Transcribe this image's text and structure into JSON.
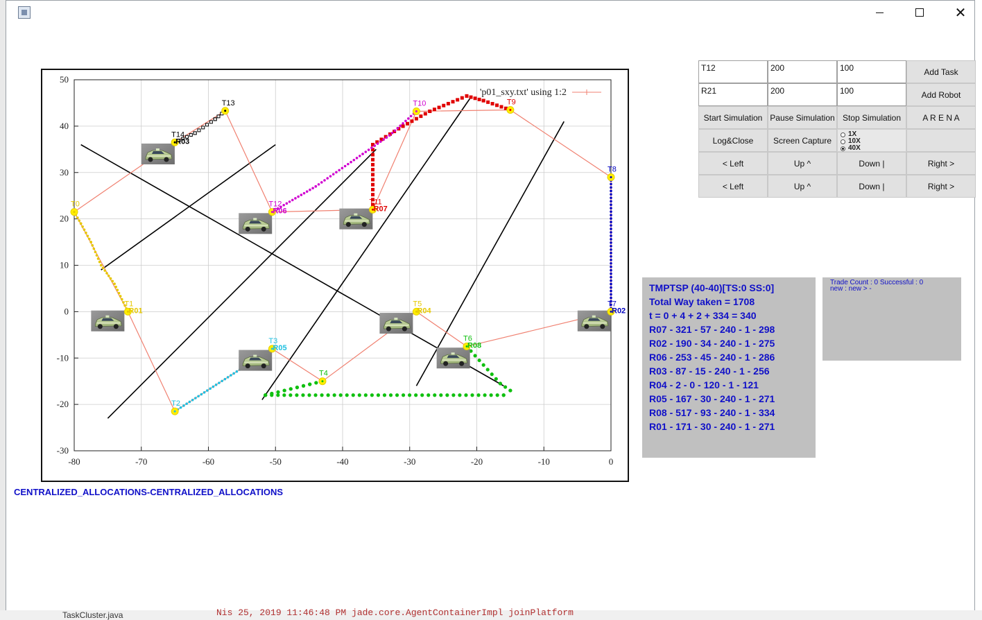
{
  "window": {
    "close_glyph": "✕",
    "bottom_code": "Nis 25, 2019 11:46:48 PM jade.core.AgentContainerImpl joinPlatform",
    "bottom_tree": "TaskCluster.java"
  },
  "allocation_label": "CENTRALIZED_ALLOCATIONS-CENTRALIZED_ALLOCATIONS",
  "controls": {
    "task_fields": [
      "T12",
      "200",
      "100"
    ],
    "add_task": "Add Task",
    "robot_fields": [
      "R21",
      "200",
      "100"
    ],
    "add_robot": "Add Robot",
    "start_simulation": "Start Simulation",
    "pause_simulation": "Pause Simulation",
    "stop_simulation": "Stop Simulation",
    "arena": "A R E N A",
    "log_close": "Log&Close",
    "screen_capture": "Screen Capture",
    "speed_options": [
      "1X",
      "10X",
      "40X"
    ],
    "speed_selected": "40X",
    "move_row_1": [
      "< Left",
      "Up ^",
      "Down |",
      "Right >"
    ],
    "move_row_2": [
      "< Left",
      "Up ^",
      "Down |",
      "Right >"
    ]
  },
  "info_panel": {
    "lines": [
      "TMPTSP (40-40)[TS:0 SS:0]",
      "Total Way taken =  1708",
      "t = 0 + 4 + 2 + 334 = 340",
      "R07 - 321 - 57 - 240 - 1 - 298",
      "R02 - 190 - 34 - 240 - 1 - 275",
      "R06 - 253 - 45 - 240 - 1 - 286",
      "R03 - 87 - 15 - 240 - 1 - 256",
      "R04 - 2 - 0 - 120 - 1 - 121",
      "R05 - 167 - 30 - 240 - 1 - 271",
      "R08 - 517 - 93 - 240 - 1 - 334",
      "R01 - 171 - 30 - 240 - 1 - 271"
    ]
  },
  "trade_panel": {
    "line1": "Trade Count : 0 Successful : 0",
    "line2": "new :  new  >  -"
  },
  "colors": {
    "route": "#f08070",
    "task_marker": "#ffee00",
    "text_blue": "#1010c8",
    "panel_gray": "#c0c0c0"
  },
  "chart_data": {
    "type": "scatter",
    "legend": "'p01_sxy.txt' using 1:2",
    "legend_position": "top-right",
    "xlim": [
      -80,
      0
    ],
    "ylim": [
      -30,
      50
    ],
    "x_ticks": [
      -80,
      -70,
      -60,
      -50,
      -40,
      -30,
      -20,
      -10,
      0
    ],
    "y_ticks": [
      50,
      40,
      30,
      20,
      10,
      0,
      -10,
      -20,
      -30
    ],
    "grid": true,
    "tasks": [
      {
        "name": "T0",
        "x": -80,
        "y": 21.5,
        "color": "#e6c800"
      },
      {
        "name": "T1",
        "x": -72,
        "y": 0,
        "color": "#e6c800"
      },
      {
        "name": "T2",
        "x": -65,
        "y": -21.5,
        "color": "#20c0e0"
      },
      {
        "name": "T3",
        "x": -50.5,
        "y": -8,
        "color": "#20c0e0"
      },
      {
        "name": "T4",
        "x": -43,
        "y": -15,
        "color": "#10c010"
      },
      {
        "name": "T5",
        "x": -29,
        "y": 0,
        "color": "#e6c800"
      },
      {
        "name": "T6",
        "x": -21.5,
        "y": -7.5,
        "color": "#10c010"
      },
      {
        "name": "T7",
        "x": 0,
        "y": 0,
        "color": "#0000c0"
      },
      {
        "name": "T8",
        "x": 0,
        "y": 29,
        "color": "#0000c0"
      },
      {
        "name": "T9",
        "x": -15,
        "y": 43.5,
        "color": "#e00000"
      },
      {
        "name": "T10",
        "x": -29,
        "y": 43.2,
        "color": "#d000d0"
      },
      {
        "name": "T11",
        "x": -35.5,
        "y": 22,
        "color": "#e00000"
      },
      {
        "name": "T12",
        "x": -50.5,
        "y": 21.5,
        "color": "#d000d0"
      },
      {
        "name": "T13",
        "x": -57.5,
        "y": 43.3,
        "color": "#000000"
      },
      {
        "name": "T14",
        "x": -65,
        "y": 36.5,
        "color": "#000000"
      }
    ],
    "robots": [
      {
        "name": "R01",
        "x": -72,
        "y": 0,
        "color": "#e6c800",
        "car_x": -75,
        "car_y": -2
      },
      {
        "name": "R02",
        "x": 0,
        "y": 0,
        "color": "#0000c0",
        "car_x": -2.5,
        "car_y": -2
      },
      {
        "name": "R03",
        "x": -65,
        "y": 36.5,
        "color": "#000000",
        "car_x": -67.5,
        "car_y": 34
      },
      {
        "name": "R04",
        "x": -29,
        "y": 0,
        "color": "#e6c800",
        "car_x": -32,
        "car_y": -2.5
      },
      {
        "name": "R05",
        "x": -50.5,
        "y": -8,
        "color": "#20c0e0",
        "car_x": -53,
        "car_y": -10.5
      },
      {
        "name": "R06",
        "x": -50.5,
        "y": 21.5,
        "color": "#d000d0",
        "car_x": -53,
        "car_y": 19
      },
      {
        "name": "R07",
        "x": -35.5,
        "y": 22,
        "color": "#e00000",
        "car_x": -38,
        "car_y": 20
      },
      {
        "name": "R08",
        "x": -21.5,
        "y": -7.5,
        "color": "#10c010",
        "car_x": -23.5,
        "car_y": -10
      }
    ],
    "route": [
      [
        -65,
        36.5
      ],
      [
        -80,
        21.5
      ],
      [
        -72,
        0
      ],
      [
        -65,
        -21.5
      ],
      [
        -50.5,
        -8
      ],
      [
        -43,
        -15
      ],
      [
        -29,
        0
      ],
      [
        -21.5,
        -7.5
      ],
      [
        0,
        0
      ],
      [
        0,
        29
      ],
      [
        -15,
        43.5
      ],
      [
        -29,
        43.2
      ],
      [
        -35.5,
        22
      ],
      [
        -50.5,
        21.5
      ],
      [
        -57.5,
        43.3
      ],
      [
        -65,
        36.5
      ]
    ],
    "walls": [
      [
        [
          -79,
          36
        ],
        [
          -16,
          -16
        ]
      ],
      [
        [
          -76,
          9
        ],
        [
          -50,
          36
        ]
      ],
      [
        [
          -75,
          -23
        ],
        [
          -35,
          35
        ]
      ],
      [
        [
          -52,
          -19
        ],
        [
          -21,
          46
        ]
      ],
      [
        [
          -29,
          -16
        ],
        [
          -7,
          41
        ]
      ]
    ],
    "paths": [
      {
        "color": "#e6c800",
        "style": "dots",
        "points": [
          [
            -80,
            21.5
          ],
          [
            -79,
            19
          ],
          [
            -77.5,
            15
          ],
          [
            -76,
            10
          ],
          [
            -74,
            6
          ],
          [
            -72,
            0
          ]
        ]
      },
      {
        "color": "#20c0e0",
        "style": "dots",
        "points": [
          [
            -65,
            -21.5
          ],
          [
            -50.5,
            -8
          ]
        ]
      },
      {
        "color": "#10c010",
        "style": "stars",
        "points": [
          [
            -51.5,
            -18
          ],
          [
            -43,
            -15
          ],
          [
            -51.5,
            -18
          ],
          [
            -16,
            -18
          ],
          [
            -15,
            -17
          ],
          [
            -16.5,
            -15.5
          ],
          [
            -21.5,
            -7.5
          ]
        ]
      },
      {
        "color": "#0000c0",
        "style": "dots",
        "points": [
          [
            0,
            29
          ],
          [
            0,
            0
          ]
        ]
      },
      {
        "color": "#e00000",
        "style": "squares",
        "points": [
          [
            -35.5,
            22
          ],
          [
            -35.5,
            36
          ],
          [
            -31,
            40
          ],
          [
            -27,
            43.2
          ],
          [
            -21.5,
            46.5
          ],
          [
            -19,
            45.5
          ],
          [
            -15,
            43.5
          ]
        ]
      },
      {
        "color": "#d000d0",
        "style": "dots",
        "points": [
          [
            -50.5,
            21.5
          ],
          [
            -44,
            27
          ],
          [
            -37,
            34
          ],
          [
            -33,
            38
          ],
          [
            -29,
            43.2
          ]
        ]
      },
      {
        "color": "#000000",
        "style": "squares",
        "points": [
          [
            -65,
            36.5
          ],
          [
            -62,
            38.5
          ],
          [
            -59,
            41.5
          ],
          [
            -57.5,
            43.3
          ]
        ]
      }
    ]
  }
}
